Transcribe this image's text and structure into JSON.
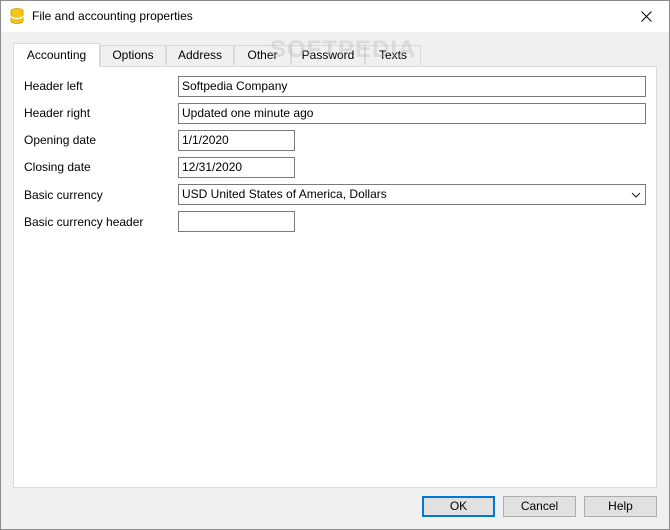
{
  "window": {
    "title": "File and accounting properties"
  },
  "watermark": "SOFTPEDIA",
  "tabs": [
    {
      "label": "Accounting",
      "active": true
    },
    {
      "label": "Options"
    },
    {
      "label": "Address"
    },
    {
      "label": "Other"
    },
    {
      "label": "Password"
    },
    {
      "label": "Texts"
    }
  ],
  "form": {
    "header_left": {
      "label": "Header left",
      "value": "Softpedia Company"
    },
    "header_right": {
      "label": "Header right",
      "value": "Updated one minute ago"
    },
    "opening_date": {
      "label": "Opening date",
      "value": "1/1/2020"
    },
    "closing_date": {
      "label": "Closing date",
      "value": "12/31/2020"
    },
    "basic_currency": {
      "label": "Basic currency",
      "value": "USD United States of America, Dollars"
    },
    "basic_currency_header": {
      "label": "Basic currency header",
      "value": ""
    }
  },
  "buttons": {
    "ok": "OK",
    "cancel": "Cancel",
    "help": "Help"
  },
  "colors": {
    "accent": "#0078d7",
    "icon": "#f5c518"
  }
}
